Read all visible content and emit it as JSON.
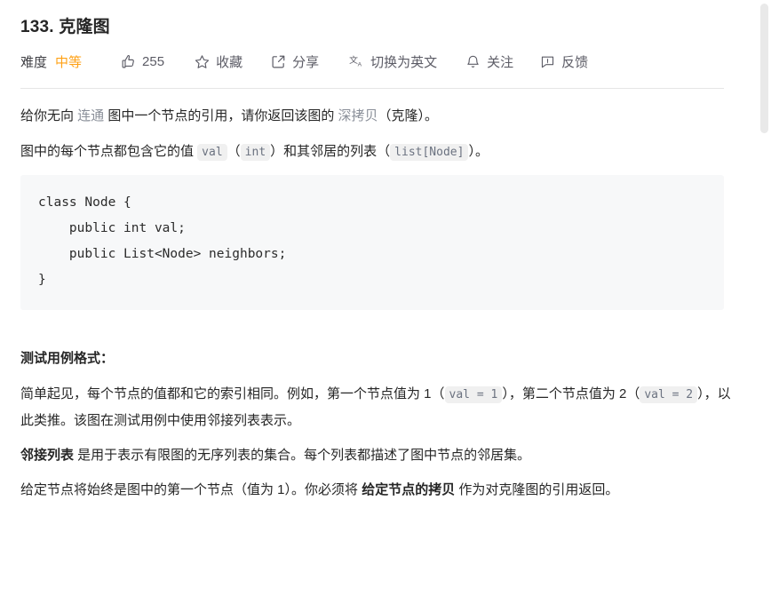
{
  "problem": {
    "title": "133. 克隆图",
    "difficulty_label": "难度",
    "difficulty_value": "中等"
  },
  "toolbar": {
    "like": {
      "icon": "thumbs-up-icon",
      "count": "255"
    },
    "favorite": {
      "icon": "star-icon",
      "label": "收藏"
    },
    "share": {
      "icon": "share-icon",
      "label": "分享"
    },
    "translate": {
      "icon": "translate-icon",
      "label": "切换为英文"
    },
    "subscribe": {
      "icon": "bell-icon",
      "label": "关注"
    },
    "feedback": {
      "icon": "feedback-icon",
      "label": "反馈"
    }
  },
  "description": {
    "p1": {
      "a": "给你无向 ",
      "link1": "连通",
      "b": " 图中一个节点的引用，请你返回该图的 ",
      "link2": "深拷贝",
      "c": "（克隆）。"
    },
    "p2": {
      "a": "图中的每个节点都包含它的值 ",
      "code1": "val",
      "b": "（",
      "code2": "int",
      "c": "）和其邻居的列表（",
      "code3": "list[Node]",
      "d": "）。"
    },
    "code_block": "class Node {\n    public int val;\n    public List<Node> neighbors;\n}"
  },
  "test_format": {
    "heading": "测试用例格式：",
    "p1": {
      "a": "简单起见，每个节点的值都和它的索引相同。例如，第一个节点值为 1（",
      "code1": "val = 1",
      "b": "），第二个节点值为 2（",
      "code2": "val = 2",
      "c": "），以此类推。该图在测试用例中使用邻接列表表示。"
    },
    "p2": {
      "bold": "邻接列表",
      "rest": " 是用于表示有限图的无序列表的集合。每个列表都描述了图中节点的邻居集。"
    },
    "p3": {
      "a": "给定节点将始终是图中的第一个节点（值为 1）。你必须将 ",
      "bold": "给定节点的拷贝",
      "b": " 作为对克隆图的引用返回。"
    }
  },
  "colors": {
    "difficulty_medium": "#ffa116",
    "link": "#8a8f99",
    "code_bg": "#f7f8f9",
    "inline_code_bg": "#f0f0f0",
    "text": "#262626",
    "divider": "#e5e5e5",
    "scrollbar_thumb": "#e9e9e9"
  }
}
